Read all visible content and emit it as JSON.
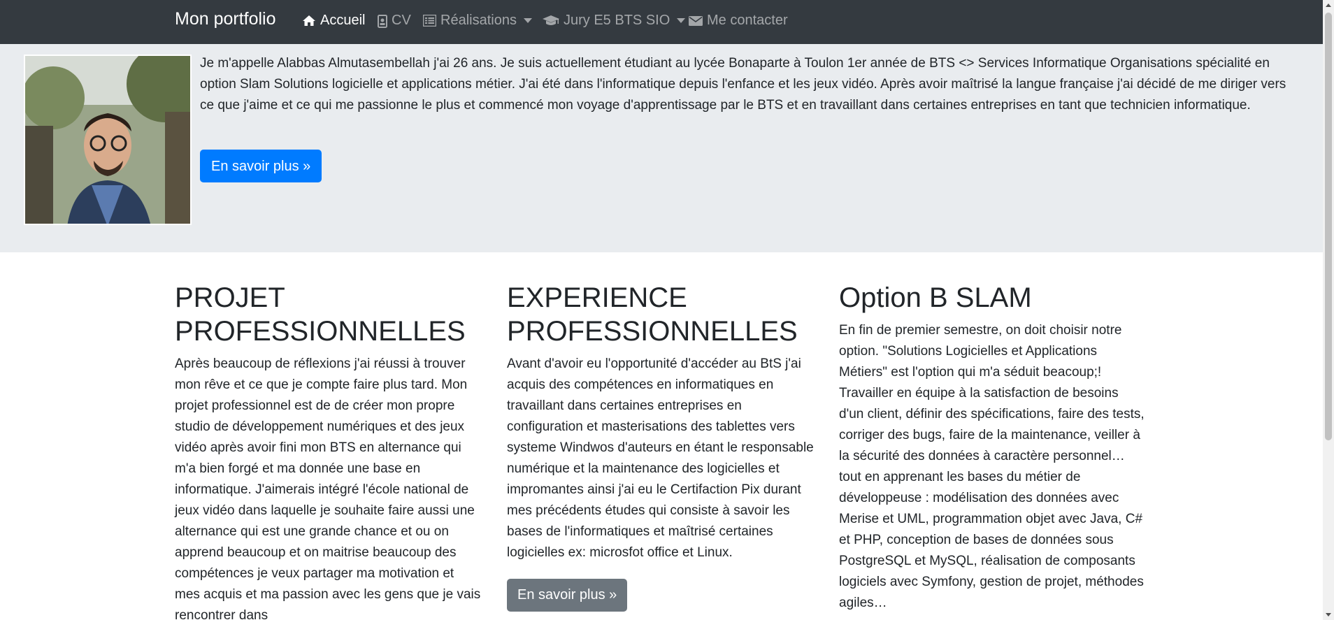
{
  "navbar": {
    "brand": "Mon portfolio",
    "items": [
      {
        "label": "Accueil",
        "icon": "home-icon",
        "active": true
      },
      {
        "label": "CV",
        "icon": "id-card-icon",
        "active": false
      },
      {
        "label": "Réalisations",
        "icon": "list-icon",
        "dropdown": true
      },
      {
        "label": "Jury E5 BTS SIO",
        "icon": "graduation-cap-icon",
        "dropdown": true
      },
      {
        "label": "Me contacter",
        "icon": "envelope-icon",
        "active": false
      }
    ]
  },
  "jumbotron": {
    "intro": "Je m'appelle Alabbas Almutasembellah j'ai 26 ans. Je suis actuellement étudiant au lycée Bonaparte à Toulon 1er année de BTS <> Services Informatique Organisations spécialité en option Slam Solutions logicielle et applications métier. J'ai été dans l'informatique depuis l'enfance et les jeux vidéo. Après avoir maîtrisé la langue française j'ai décidé de me diriger vers ce que j'aime et ce qui me passionne le plus et commencé mon voyage d'apprentissage par le BTS et en travaillant dans certaines entreprises en tant que technicien informatique.",
    "button": "En savoir plus »"
  },
  "columns": [
    {
      "title": "PROJET PROFESSIONNELLES",
      "text": "Après beaucoup de réflexions j'ai réussi à trouver mon rêve et ce que je compte faire plus tard. Mon projet professionnel est de de créer mon propre studio de développement numériques et des jeux vidéo après avoir fini mon BTS en alternance qui m'a bien forgé et ma donnée une base en informatique. J'aimerais intégré l'école national de jeux vidéo dans laquelle je souhaite faire aussi une alternance qui est une grande chance et ou on apprend beaucoup et on maitrise beaucoup des compétences je veux partager ma motivation et mes acquis et ma passion avec les gens que je vais rencontrer dans"
    },
    {
      "title": "EXPERIENCE PROFESSIONNELLES",
      "text": "Avant d'avoir eu l'opportunité d'accéder au BtS j'ai acquis des compétences en informatiques en travaillant dans certaines entreprises en configuration et masterisations des tablettes vers systeme Windwos d'auteurs en étant le responsable numérique et la maintenance des logicielles et impromantes ainsi j'ai eu le Certifaction Pix durant mes précédents études qui consiste à savoir les bases de l'informatiques et maîtrisé certaines logicielles ex: microsfot office et Linux.",
      "button": "En savoir plus »"
    },
    {
      "title": "Option B SLAM",
      "text": "En fin de premier semestre, on doit choisir notre option. \"Solutions Logicielles et Applications Métiers\" est l'option qui m'a séduit beacoup;! Travailler en équipe à la satisfaction de besoins d'un client, définir des spécifications, faire des tests, corriger des bugs, faire de la maintenance, veiller à la sécurité des données à caractère personnel… tout en apprenant les bases du métier de développeuse : modélisation des données avec Merise et UML, programmation objet avec Java, C# et PHP, conception de bases de données sous PostgreSQL et MySQL, réalisation de composants logiciels avec Symfony, gestion de projet, méthodes agiles…"
    }
  ],
  "colors": {
    "navbar_bg": "#343a40",
    "jumbotron_bg": "#e9ecef",
    "primary": "#007bff",
    "secondary": "#6c757d"
  }
}
